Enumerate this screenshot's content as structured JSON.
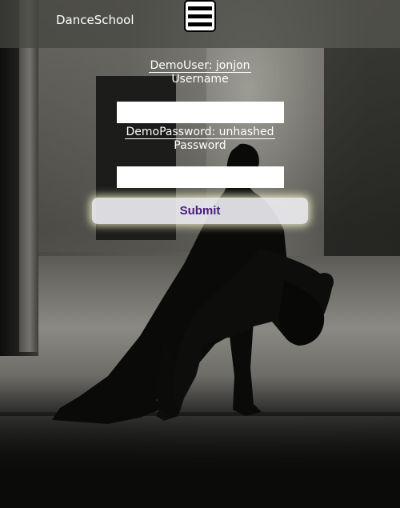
{
  "header": {
    "brand": "DanceSchool",
    "menu_icon": "hamburger-menu-icon"
  },
  "login": {
    "demo_user_hint": "DemoUser: jonjon",
    "username_label": "Username",
    "username_value": "",
    "demo_password_hint": "DemoPassword: unhashed",
    "password_label": "Password",
    "password_value": "",
    "submit_label": "Submit"
  },
  "colors": {
    "header_bg": "#46463f",
    "submit_text": "#4a1d7a",
    "submit_glow": "#ffffd2"
  }
}
